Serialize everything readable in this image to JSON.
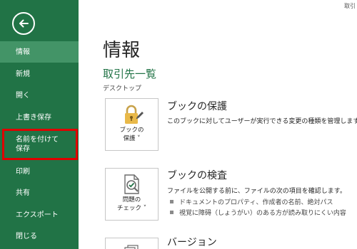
{
  "window": {
    "top_label": "取引"
  },
  "sidebar": {
    "back_icon": "back-arrow-icon",
    "items": [
      {
        "label": "情報"
      },
      {
        "label": "新規"
      },
      {
        "label": "開く"
      },
      {
        "label": "上書き保存"
      },
      {
        "label": "名前を付けて"
      },
      {
        "label": "保存"
      },
      {
        "label": "印刷"
      },
      {
        "label": "共有"
      },
      {
        "label": "エクスポート"
      },
      {
        "label": "閉じる"
      }
    ],
    "active_index": 0,
    "highlighted_index": 4,
    "colors": {
      "background": "#217346",
      "active": "#439467",
      "highlight_border": "#e00000"
    }
  },
  "main": {
    "title": "情報",
    "document_name": "取引先一覧",
    "document_location": "デスクトップ",
    "sections": [
      {
        "tile_icon": "lock-icon",
        "tile_label_line1": "ブックの",
        "tile_label_line2": "保護 ˅",
        "title": "ブックの保護",
        "description": "このブックに対してユーザーが実行できる変更の種類を管理します。"
      },
      {
        "tile_icon": "inspect-document-icon",
        "tile_label_line1": "問題の",
        "tile_label_line2": "チェック ˅",
        "title": "ブックの検査",
        "description": "ファイルを公開する前に、ファイルの次の項目を確認します。",
        "bullets": [
          "ドキュメントのプロパティ、作成者の名前、絶対パス",
          "視覚に障碍（しょうがい）のある方が読み取りにくい内容"
        ]
      },
      {
        "tile_icon": "versions-icon",
        "title": "バージョン"
      }
    ]
  }
}
